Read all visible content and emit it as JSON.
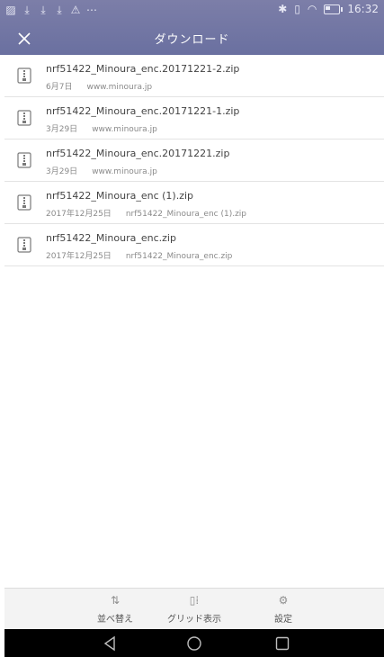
{
  "statusbar": {
    "left_icons": [
      "image-icon",
      "download-icon",
      "download-icon",
      "download-icon",
      "warning-icon",
      "more-icon"
    ],
    "time": "16:32"
  },
  "header": {
    "title": "ダウンロード",
    "close_icon": "close-icon"
  },
  "downloads": [
    {
      "name": "nrf51422_Minoura_enc.20171221-2.zip",
      "date": "6月7日",
      "source": "www.minoura.jp"
    },
    {
      "name": "nrf51422_Minoura_enc.20171221-1.zip",
      "date": "3月29日",
      "source": "www.minoura.jp"
    },
    {
      "name": "nrf51422_Minoura_enc.20171221.zip",
      "date": "3月29日",
      "source": "www.minoura.jp"
    },
    {
      "name": "nrf51422_Minoura_enc (1).zip",
      "date": "2017年12月25日",
      "source": "nrf51422_Minoura_enc (1).zip"
    },
    {
      "name": "nrf51422_Minoura_enc.zip",
      "date": "2017年12月25日",
      "source": "nrf51422_Minoura_enc.zip"
    }
  ],
  "toolbar": {
    "sort_label": "並べ替え",
    "grid_label": "グリッド表示",
    "settings_label": "設定"
  },
  "colors": {
    "header": "#6e73a3",
    "toolbar": "#f3f3f3",
    "navbar": "#000000"
  }
}
